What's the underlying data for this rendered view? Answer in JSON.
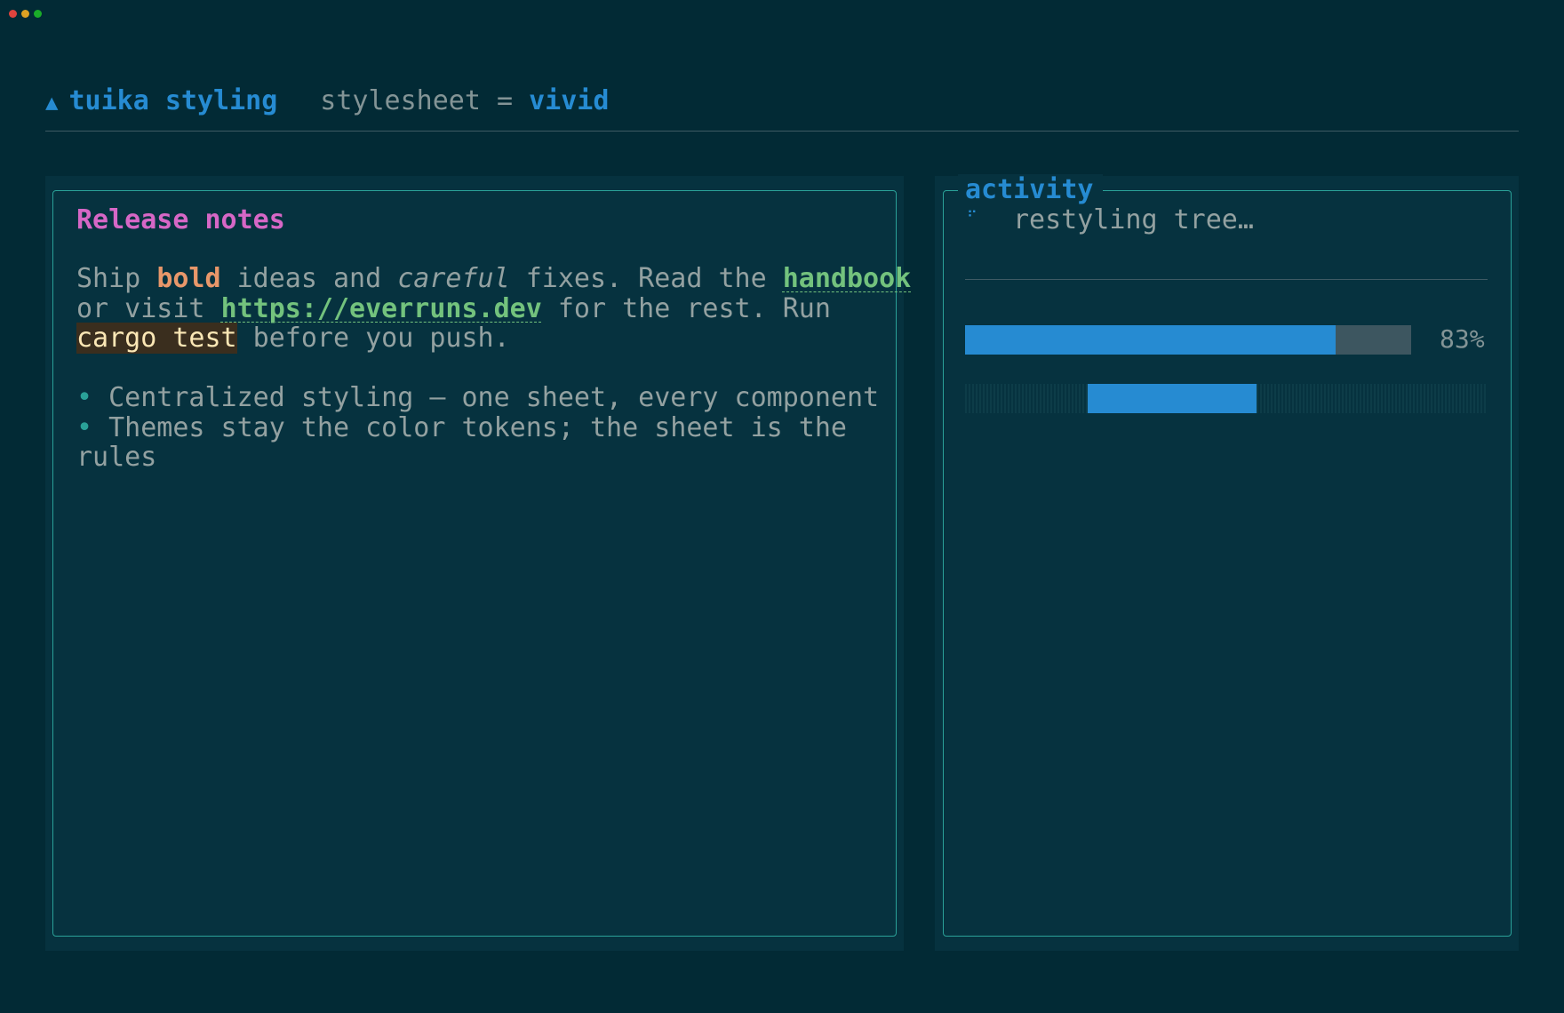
{
  "header": {
    "app_name": "tuika styling",
    "stylesheet_label": "stylesheet =",
    "stylesheet_value": "vivid"
  },
  "release_notes": {
    "title": "Release notes",
    "p1": "Ship ",
    "bold_word": "bold",
    "p2": " ideas and ",
    "italic_word": "careful",
    "p3": " fixes. Read the ",
    "link1": "handbook",
    "p4": "\nor visit ",
    "link2": "https://everruns.dev",
    "p5": " for the rest. Run\n",
    "code": "cargo test",
    "p6": " before you push.",
    "bullet_glyph": "•",
    "bullet1": " Centralized styling — one sheet, every component",
    "bullet2": " Themes stay the color tokens; the sheet is the\nrules"
  },
  "activity": {
    "title": "activity",
    "spinner_glyph": "⠋",
    "status": "restyling tree…",
    "progress_label": "83%",
    "progress_value": 0.83
  },
  "colors": {
    "background": "#022a35",
    "panel": "#06323f",
    "accent": "#268bd2",
    "border": "#2aa198",
    "bold": "#e8976a",
    "link": "#73c27d",
    "heading": "#d667c6"
  }
}
